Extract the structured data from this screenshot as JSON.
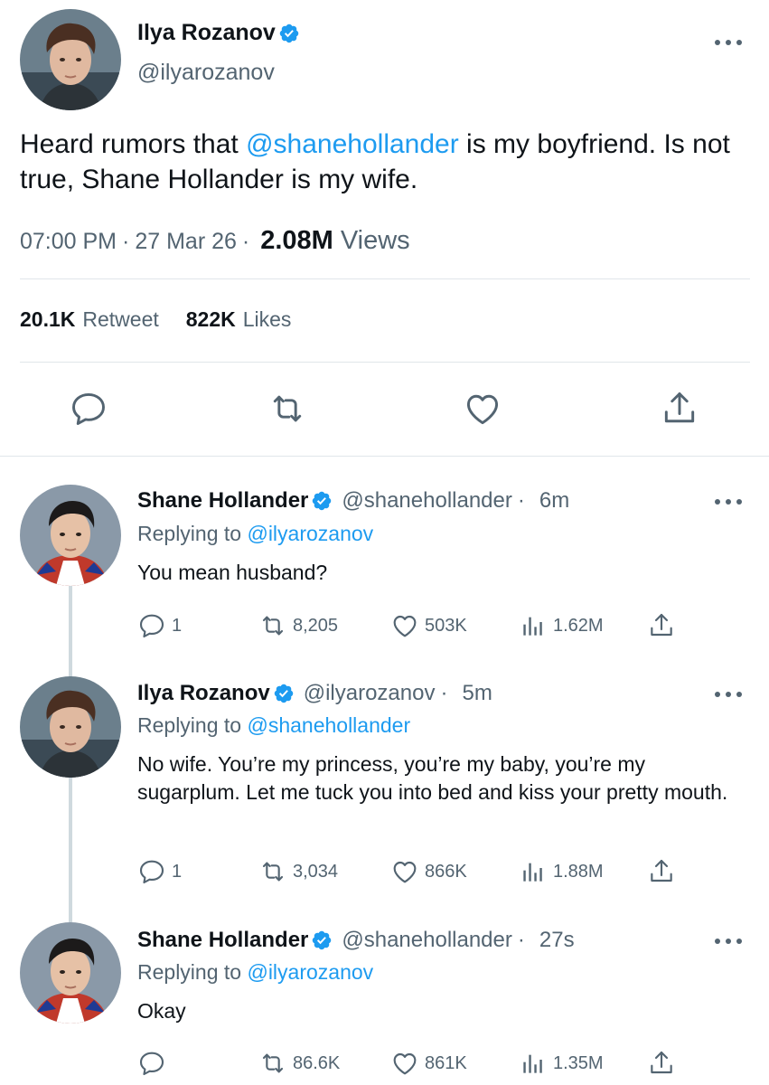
{
  "main": {
    "name": "Ilya Rozanov",
    "handle": "@ilyarozanov",
    "text_pre": "Heard rumors that ",
    "mention": "@shanehollander",
    "text_post": " is my boyfriend. Is not true, Shane Hollander is my wife.",
    "time": "07:00 PM",
    "date": "27 Mar 26",
    "views_count": "2.08M",
    "views_label": "Views",
    "retweets_count": "20.1K",
    "retweets_label": "Retweet",
    "likes_count": "822K",
    "likes_label": "Likes",
    "actions": [
      "reply-icon",
      "retweet-icon",
      "like-icon",
      "share-icon"
    ]
  },
  "replies": [
    {
      "name": "Shane Hollander",
      "handle": "@shanehollander",
      "time": "6m",
      "replying_label": "Replying to",
      "replying_to": "@ilyarozanov",
      "text": "You mean husband?",
      "reply_count": "1",
      "retweet_count": "8,205",
      "like_count": "503K",
      "view_count": "1.62M"
    },
    {
      "name": "Ilya Rozanov",
      "handle": "@ilyarozanov",
      "time": "5m",
      "replying_label": "Replying to",
      "replying_to": "@shanehollander",
      "text": "No wife. You’re my princess, you’re my baby, you’re my sugarplum.  Let me tuck you into bed and kiss your pretty mouth.",
      "reply_count": "1",
      "retweet_count": "3,034",
      "like_count": "866K",
      "view_count": "1.88M"
    },
    {
      "name": "Shane Hollander",
      "handle": "@shanehollander",
      "time": "27s",
      "replying_label": "Replying to",
      "replying_to": "@ilyarozanov",
      "text": "Okay",
      "reply_count": "",
      "retweet_count": "86.6K",
      "like_count": "861K",
      "view_count": "1.35M"
    }
  ],
  "colors": {
    "accent": "#1d9bf0",
    "text": "#0f1419",
    "secondary": "#536471",
    "divider": "#e1e6ea"
  }
}
